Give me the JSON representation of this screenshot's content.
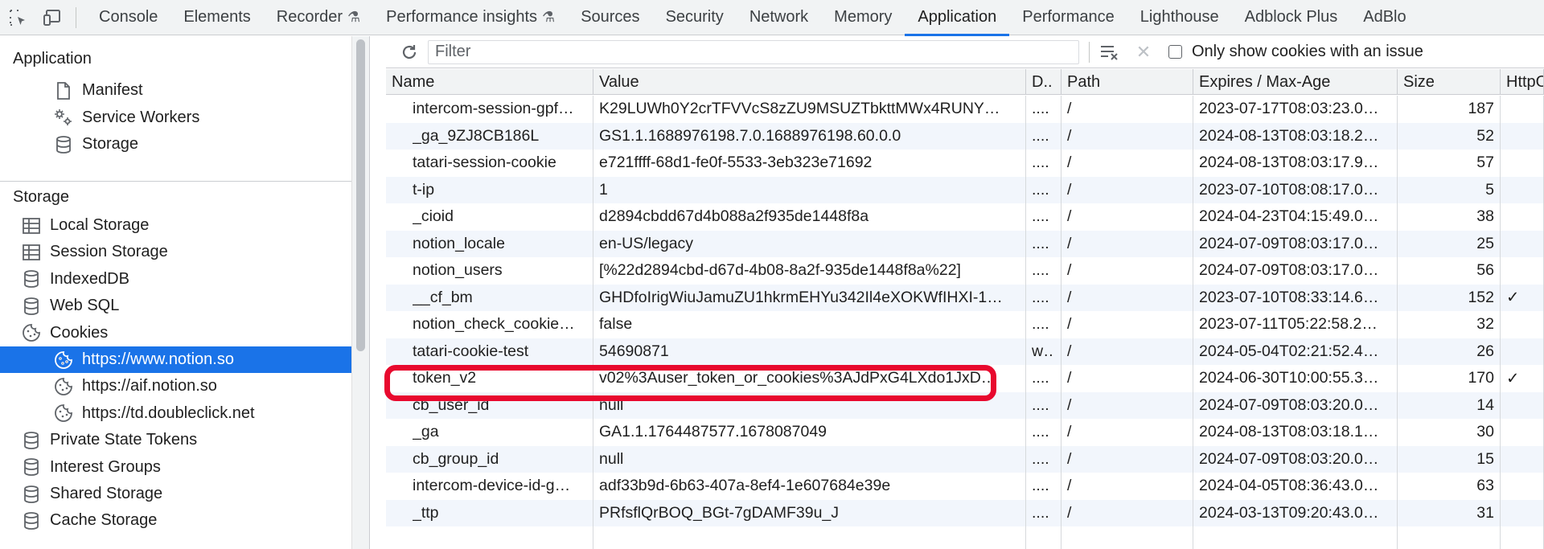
{
  "toolbar": {
    "tabs": [
      {
        "label": "Console"
      },
      {
        "label": "Elements"
      },
      {
        "label": "Recorder",
        "experimental": true
      },
      {
        "label": "Performance insights",
        "experimental": true
      },
      {
        "label": "Sources"
      },
      {
        "label": "Security"
      },
      {
        "label": "Network"
      },
      {
        "label": "Memory"
      },
      {
        "label": "Application",
        "active": true
      },
      {
        "label": "Performance"
      },
      {
        "label": "Lighthouse"
      },
      {
        "label": "Adblock Plus"
      },
      {
        "label": "AdBlo"
      }
    ]
  },
  "sidebar": {
    "application_header": "Application",
    "application_items": [
      {
        "label": "Manifest",
        "icon": "document-icon"
      },
      {
        "label": "Service Workers",
        "icon": "gears-icon"
      },
      {
        "label": "Storage",
        "icon": "database-icon"
      }
    ],
    "storage_header": "Storage",
    "storage_items": [
      {
        "label": "Local Storage",
        "icon": "table-icon",
        "expandable": true
      },
      {
        "label": "Session Storage",
        "icon": "table-icon",
        "expandable": true
      },
      {
        "label": "IndexedDB",
        "icon": "database-icon",
        "expandable": true
      },
      {
        "label": "Web SQL",
        "icon": "database-icon",
        "expandable": true
      },
      {
        "label": "Cookies",
        "icon": "cookie-icon",
        "expanded": true
      },
      {
        "label": "https://www.notion.so",
        "icon": "cookie-icon",
        "child": true,
        "selected": true
      },
      {
        "label": "https://aif.notion.so",
        "icon": "cookie-icon",
        "child": true
      },
      {
        "label": "https://td.doubleclick.net",
        "icon": "cookie-icon",
        "child": true
      },
      {
        "label": "Private State Tokens",
        "icon": "database-icon"
      },
      {
        "label": "Interest Groups",
        "icon": "database-icon"
      },
      {
        "label": "Shared Storage",
        "icon": "database-icon",
        "expandable": true
      },
      {
        "label": "Cache Storage",
        "icon": "database-icon"
      }
    ]
  },
  "filterbar": {
    "filter_placeholder": "Filter",
    "only_issues_label": "Only show cookies with an issue"
  },
  "table": {
    "columns": [
      "Name",
      "Value",
      "D..",
      "Path",
      "Expires / Max-Age",
      "Size",
      "HttpO"
    ],
    "rows": [
      {
        "name": "intercom-session-gpf…",
        "value": "K29LUWh0Y2crTFVVcS8zZU9MSUZTbkttMWx4RUNY…",
        "domain": "....",
        "path": "/",
        "expires": "2023-07-17T08:03:23.0…",
        "size": "187",
        "httponly": ""
      },
      {
        "name": "_ga_9ZJ8CB186L",
        "value": "GS1.1.1688976198.7.0.1688976198.60.0.0",
        "domain": "....",
        "path": "/",
        "expires": "2024-08-13T08:03:18.2…",
        "size": "52",
        "httponly": ""
      },
      {
        "name": "tatari-session-cookie",
        "value": "e721ffff-68d1-fe0f-5533-3eb323e71692",
        "domain": "....",
        "path": "/",
        "expires": "2024-08-13T08:03:17.9…",
        "size": "57",
        "httponly": ""
      },
      {
        "name": "t-ip",
        "value": "1",
        "domain": "....",
        "path": "/",
        "expires": "2023-07-10T08:08:17.0…",
        "size": "5",
        "httponly": ""
      },
      {
        "name": "_cioid",
        "value": "d2894cbdd67d4b088a2f935de1448f8a",
        "domain": "....",
        "path": "/",
        "expires": "2024-04-23T04:15:49.0…",
        "size": "38",
        "httponly": ""
      },
      {
        "name": "notion_locale",
        "value": "en-US/legacy",
        "domain": "....",
        "path": "/",
        "expires": "2024-07-09T08:03:17.0…",
        "size": "25",
        "httponly": ""
      },
      {
        "name": "notion_users",
        "value": "[%22d2894cbd-d67d-4b08-8a2f-935de1448f8a%22]",
        "domain": "....",
        "path": "/",
        "expires": "2024-07-09T08:03:17.0…",
        "size": "56",
        "httponly": ""
      },
      {
        "name": "__cf_bm",
        "value": "GHDfoIrigWiuJamuZU1hkrmEHYu342Il4eXOKWfIHXI-1…",
        "domain": "....",
        "path": "/",
        "expires": "2023-07-10T08:33:14.6…",
        "size": "152",
        "httponly": "✓"
      },
      {
        "name": "notion_check_cookie…",
        "value": "false",
        "domain": "....",
        "path": "/",
        "expires": "2023-07-11T05:22:58.2…",
        "size": "32",
        "httponly": ""
      },
      {
        "name": "tatari-cookie-test",
        "value": "54690871",
        "domain": "w…",
        "path": "/",
        "expires": "2024-05-04T02:21:52.4…",
        "size": "26",
        "httponly": ""
      },
      {
        "name": "token_v2",
        "value": "v02%3Auser_token_or_cookies%3AJdPxG4LXdo1JxD…",
        "domain": "....",
        "path": "/",
        "expires": "2024-06-30T10:00:55.3…",
        "size": "170",
        "httponly": "✓"
      },
      {
        "name": "cb_user_id",
        "value": "null",
        "domain": "....",
        "path": "/",
        "expires": "2024-07-09T08:03:20.0…",
        "size": "14",
        "httponly": ""
      },
      {
        "name": "_ga",
        "value": "GA1.1.1764487577.1678087049",
        "domain": "....",
        "path": "/",
        "expires": "2024-08-13T08:03:18.1…",
        "size": "30",
        "httponly": ""
      },
      {
        "name": "cb_group_id",
        "value": "null",
        "domain": "....",
        "path": "/",
        "expires": "2024-07-09T08:03:20.0…",
        "size": "15",
        "httponly": ""
      },
      {
        "name": "intercom-device-id-g…",
        "value": "adf33b9d-6b63-407a-8ef4-1e607684e39e",
        "domain": "....",
        "path": "/",
        "expires": "2024-04-05T08:36:43.0…",
        "size": "63",
        "httponly": ""
      },
      {
        "name": "_ttp",
        "value": "PRfsflQrBOQ_BGt-7gDAMF39u_J",
        "domain": "....",
        "path": "/",
        "expires": "2024-03-13T09:20:43.0…",
        "size": "31",
        "httponly": ""
      }
    ]
  },
  "colors": {
    "accent": "#1a73e8",
    "highlight": "#e8092e"
  }
}
